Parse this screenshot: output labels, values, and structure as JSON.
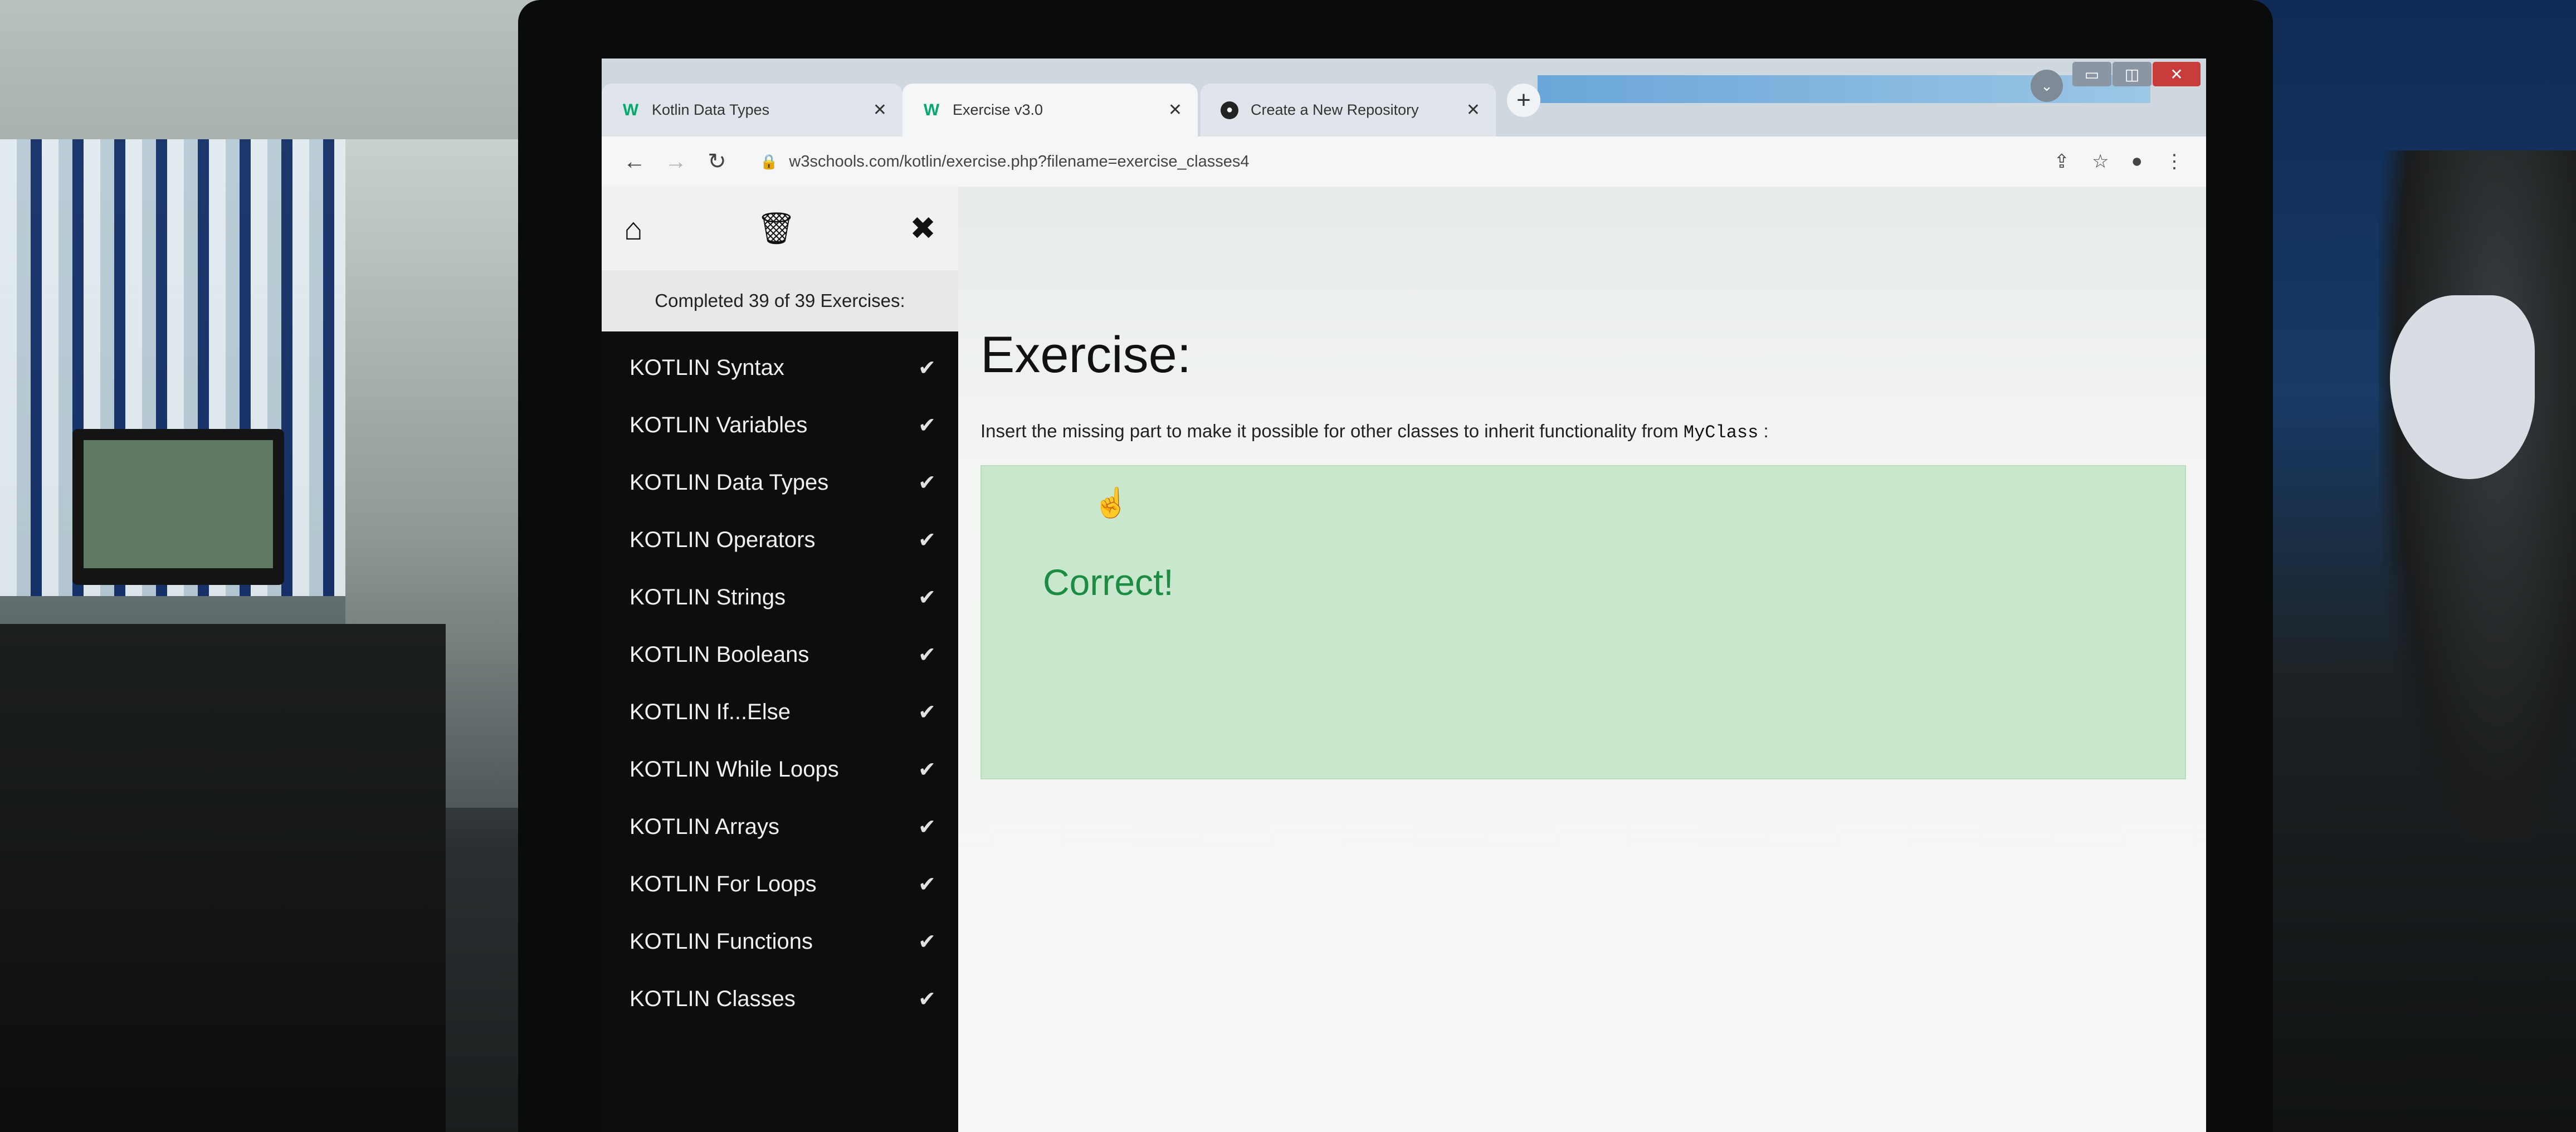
{
  "browser": {
    "tabs": [
      {
        "title": "Kotlin Data Types",
        "favicon": "w3schools-icon",
        "active": false
      },
      {
        "title": "Exercise v3.0",
        "favicon": "w3schools-icon",
        "active": true
      },
      {
        "title": "Create a New Repository",
        "favicon": "github-icon",
        "active": false
      }
    ],
    "url": "w3schools.com/kotlin/exercise.php?filename=exercise_classes4"
  },
  "sidebar": {
    "progress": "Completed 39 of 39 Exercises:",
    "items": [
      {
        "label": "KOTLIN Syntax",
        "done": true
      },
      {
        "label": "KOTLIN Variables",
        "done": true
      },
      {
        "label": "KOTLIN Data Types",
        "done": true
      },
      {
        "label": "KOTLIN Operators",
        "done": true
      },
      {
        "label": "KOTLIN Strings",
        "done": true
      },
      {
        "label": "KOTLIN Booleans",
        "done": true
      },
      {
        "label": "KOTLIN If...Else",
        "done": true
      },
      {
        "label": "KOTLIN While Loops",
        "done": true
      },
      {
        "label": "KOTLIN Arrays",
        "done": true
      },
      {
        "label": "KOTLIN For Loops",
        "done": true
      },
      {
        "label": "KOTLIN Functions",
        "done": true
      },
      {
        "label": "KOTLIN Classes",
        "done": true
      }
    ]
  },
  "exercise": {
    "title": "Exercise:",
    "instruction": "Insert the missing part to make it possible for other classes to inherit functionality from",
    "code_ref": "MyClass",
    "instruction_end": ":",
    "result": "Correct!"
  },
  "colors": {
    "sidebar_bg": "#0d0d0d",
    "correct_green": "#1d8c43",
    "result_bg": "#c9e7cd",
    "w3_green": "#04aa6d"
  }
}
